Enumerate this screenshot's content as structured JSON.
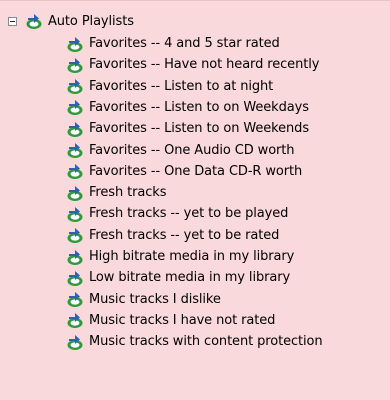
{
  "tree": {
    "root_label": "Auto Playlists",
    "items": [
      "Favorites -- 4 and 5 star rated",
      "Favorites -- Have not heard recently",
      "Favorites -- Listen to at night",
      "Favorites -- Listen to on Weekdays",
      "Favorites -- Listen to on Weekends",
      "Favorites -- One Audio CD worth",
      "Favorites -- One Data CD-R worth",
      "Fresh tracks",
      "Fresh tracks -- yet to be played",
      "Fresh tracks -- yet to be rated",
      "High bitrate media in my library",
      "Low bitrate media in my library",
      "Music tracks I dislike",
      "Music tracks I have not rated",
      "Music tracks with content protection"
    ]
  },
  "colors": {
    "background": "#f9d9dc",
    "icon_green": "#2e9a3a",
    "icon_blue": "#2a62b8"
  },
  "icons": {
    "expander": "collapse-minus-icon",
    "playlist": "auto-playlist-icon"
  }
}
